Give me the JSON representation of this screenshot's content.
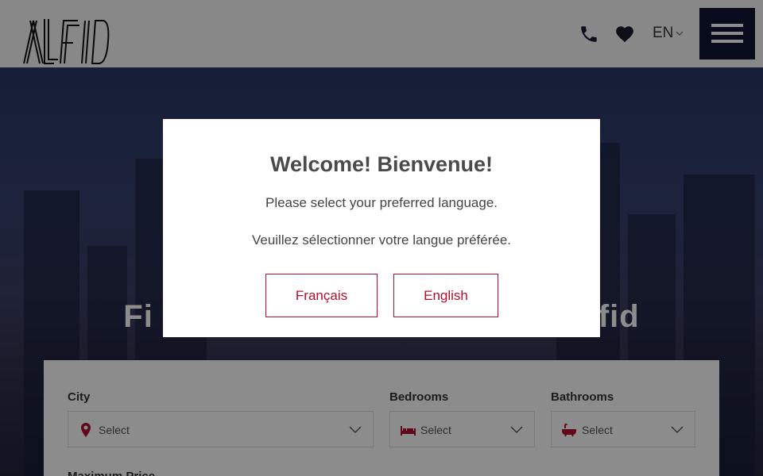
{
  "header": {
    "logo_alt": "ALFID",
    "phone_icon": "phone-icon",
    "heart_icon": "heart-icon",
    "language": "EN",
    "menu_icon": "hamburger-icon"
  },
  "hero": {
    "title_left": "Fi",
    "title_right": "fid"
  },
  "search": {
    "city_label": "City",
    "city_placeholder": "Select",
    "bedrooms_label": "Bedrooms",
    "bedrooms_placeholder": "Select",
    "bathrooms_label": "Bathrooms",
    "bathrooms_placeholder": "Select",
    "max_price_label": "Maximum Price"
  },
  "modal": {
    "title": "Welcome! Bienvenue!",
    "text_en": "Please select your preferred language.",
    "text_fr": "Veuillez sélectionner votre langue préférée.",
    "button_fr": "Français",
    "button_en": "English"
  },
  "colors": {
    "accent": "#b0102c",
    "navy": "#0d1433"
  }
}
